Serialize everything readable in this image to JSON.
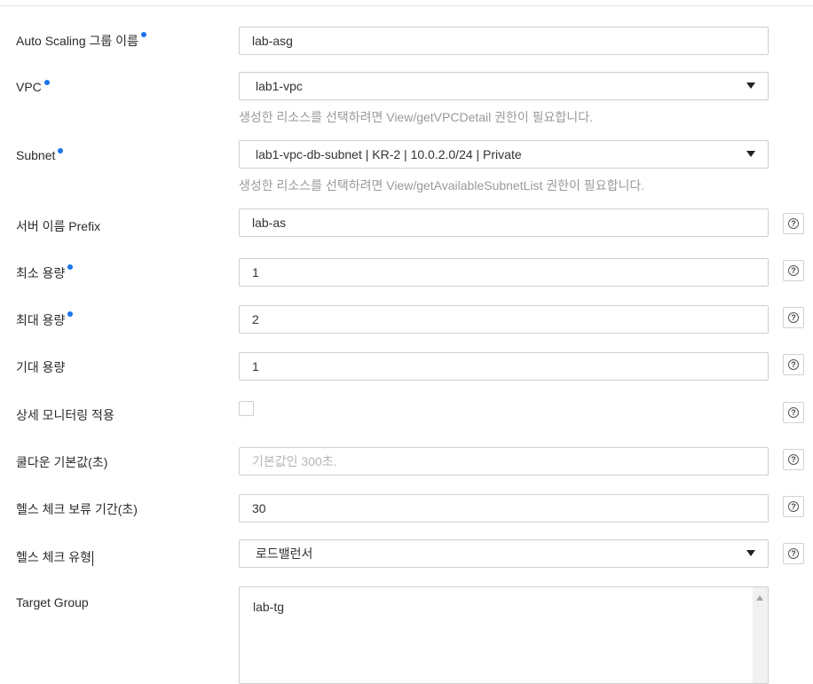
{
  "form": {
    "asg_name": {
      "label": "Auto Scaling 그룹 이름",
      "value": "lab-asg"
    },
    "vpc": {
      "label": "VPC",
      "value": "lab1-vpc",
      "hint": "생성한 리소스를 선택하려면 View/getVPCDetail 권한이 필요합니다."
    },
    "subnet": {
      "label": "Subnet",
      "value": "lab1-vpc-db-subnet | KR-2 | 10.0.2.0/24 | Private",
      "hint": "생성한 리소스를 선택하려면 View/getAvailableSubnetList 권한이 필요합니다."
    },
    "server_prefix": {
      "label": "서버 이름 Prefix",
      "value": "lab-as"
    },
    "min_capacity": {
      "label": "최소 용량",
      "value": "1"
    },
    "max_capacity": {
      "label": "최대 용량",
      "value": "2"
    },
    "desired_capacity": {
      "label": "기대 용량",
      "value": "1"
    },
    "detailed_monitoring": {
      "label": "상세 모니터링 적용",
      "checked": false
    },
    "cooldown": {
      "label": "쿨다운 기본값(초)",
      "placeholder": "기본값인 300초."
    },
    "health_grace": {
      "label": "헬스 체크 보류 기간(초)",
      "value": "30"
    },
    "health_type": {
      "label": "헬스 체크 유형",
      "value": "로드밸런서"
    },
    "target_group": {
      "label": "Target Group",
      "items": [
        "lab-tg"
      ]
    }
  },
  "help_icon_glyph": "?",
  "colors": {
    "required_dot": "#1a73e8",
    "hint_text": "#9a9a9a",
    "border": "#cfcfcf"
  }
}
